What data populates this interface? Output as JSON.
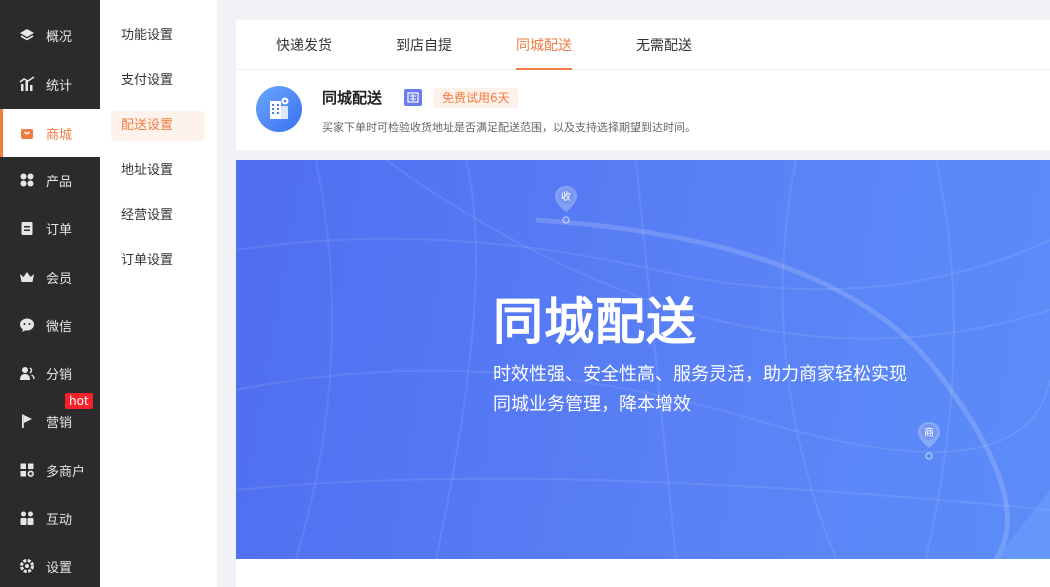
{
  "sidebar": {
    "items": [
      {
        "label": "概况",
        "icon": "layers-icon"
      },
      {
        "label": "统计",
        "icon": "chart-icon"
      },
      {
        "label": "商城",
        "icon": "shop-bag-icon",
        "active": true
      },
      {
        "label": "产品",
        "icon": "grid-icon"
      },
      {
        "label": "订单",
        "icon": "clipboard-icon"
      },
      {
        "label": "会员",
        "icon": "crown-icon"
      },
      {
        "label": "微信",
        "icon": "wechat-icon"
      },
      {
        "label": "分销",
        "icon": "users-icon"
      },
      {
        "label": "营销",
        "icon": "flag-icon"
      },
      {
        "label": "多商户",
        "icon": "store-plus-icon"
      },
      {
        "label": "互动",
        "icon": "people-icon"
      },
      {
        "label": "设置",
        "icon": "gear-icon"
      }
    ],
    "hot_badge": "hot"
  },
  "submenu": {
    "items": [
      "功能设置",
      "支付设置",
      "配送设置",
      "地址设置",
      "经营设置",
      "订单设置"
    ],
    "active_index": 2
  },
  "tabs": [
    "快递发货",
    "到店自提",
    "同城配送",
    "无需配送"
  ],
  "active_tab": 2,
  "info": {
    "title": "同城配送",
    "trial": "免费试用6天",
    "desc": "买家下单时可检验收货地址是否满足配送范围，以及支持选择期望到达时间。"
  },
  "banner": {
    "title": "同城配送",
    "text": "时效性强、安全性高、服务灵活，助力商家轻松实现同城业务管理，降本增效",
    "pin_receive": "收",
    "pin_shop": "商"
  },
  "colors": {
    "accent": "#f07c41",
    "sidebar_bg": "#2b2b2b",
    "banner": "#5478f2"
  }
}
